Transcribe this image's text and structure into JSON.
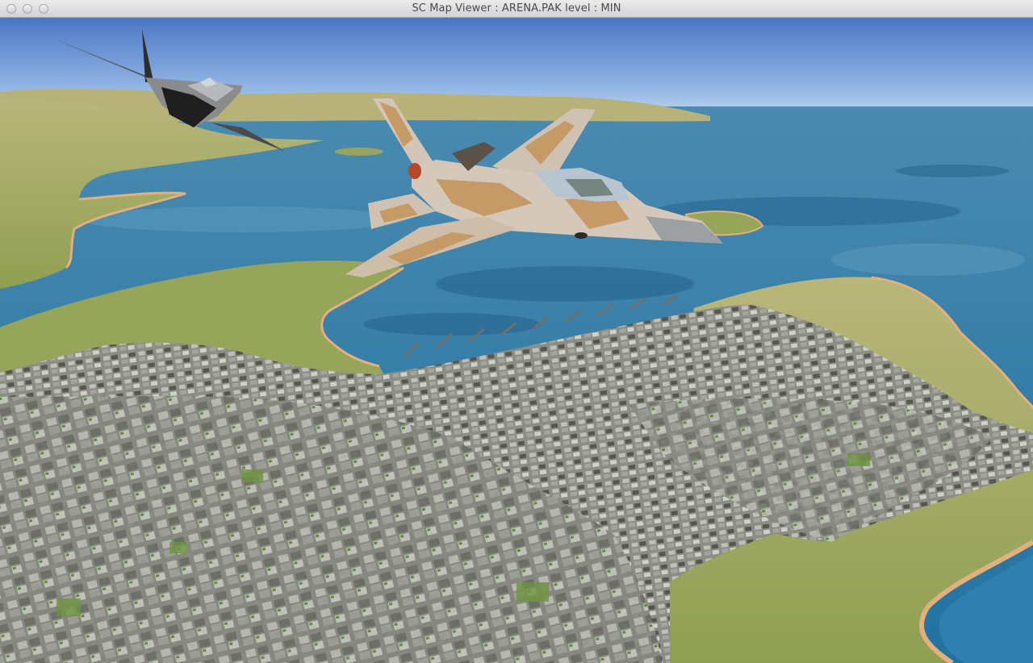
{
  "window": {
    "title": "SC Map Viewer : ARENA.PAK level : MIN"
  },
  "scene": {
    "colors": {
      "sky_top": "#4f7ac8",
      "sky_horizon": "#c9ddf2",
      "water": "#2f7aa6",
      "water_dark": "#1e5f8c",
      "land": "#96a45a",
      "land_light": "#b6b479",
      "beach": "#e2b07d",
      "city": "#7d7f78",
      "camo_light": "#d8cfc3",
      "camo_tan": "#c9a070",
      "stealth_dark": "#2a2a2a"
    }
  },
  "icons": {
    "close": "close-icon",
    "minimize": "minimize-icon",
    "zoom": "zoom-icon"
  }
}
